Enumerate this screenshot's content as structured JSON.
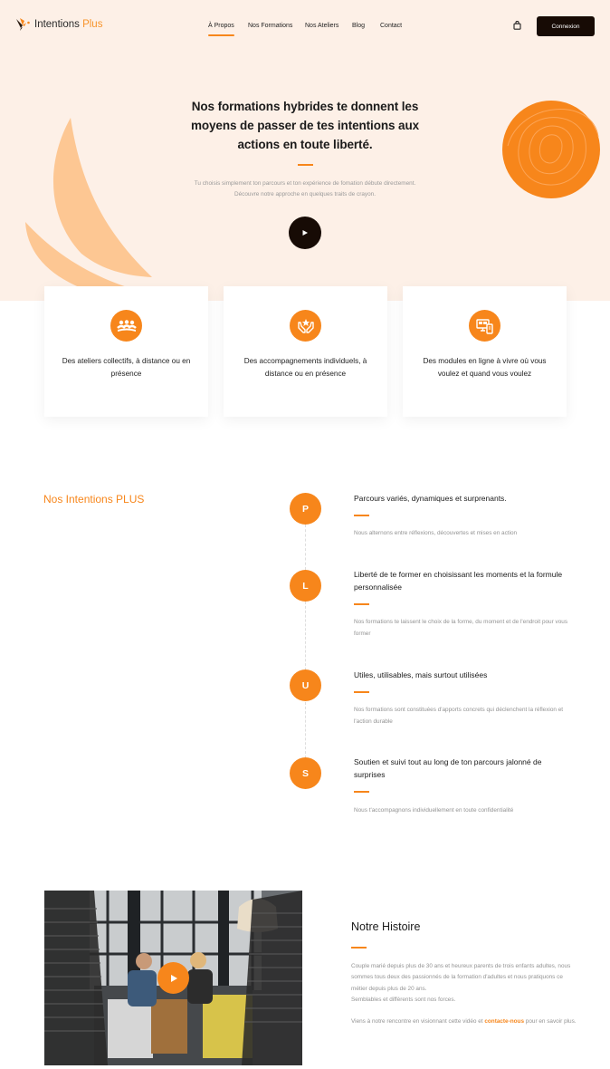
{
  "header": {
    "logo": {
      "name": "Intentions",
      "accent": "Plus"
    },
    "nav": [
      {
        "label": "À Propos",
        "active": true
      },
      {
        "label": "Nos Formations",
        "active": false
      },
      {
        "label": "Nos Ateliers",
        "active": false
      },
      {
        "label": "Blog",
        "active": false
      },
      {
        "label": "Contact",
        "active": false
      }
    ],
    "cart_icon": "shopping-bag-icon",
    "login_label": "Connexion"
  },
  "hero": {
    "title": "Nos formations hybrides te donnent les moyens de passer de tes intentions aux actions en toute liberté.",
    "subtitle_line1": "Tu choisis simplement ton parcours et ton expérience de fomation débute directement.",
    "subtitle_line2": "Découvre notre approche en quelques traits de crayon.",
    "play_icon": "play-icon"
  },
  "features": [
    {
      "icon": "group-meeting-icon",
      "text": "Des ateliers collectifs, à distance ou en présence"
    },
    {
      "icon": "hands-star-icon",
      "text": "Des accompagnements individuels, à distance ou en présence"
    },
    {
      "icon": "devices-icon",
      "text": "Des modules en ligne à vivre où vous voulez et quand vous voulez"
    }
  ],
  "intentions": {
    "title": "Nos Intentions PLUS",
    "steps": [
      {
        "letter": "P",
        "title": "Parcours variés, dynamiques et surprenants.",
        "desc": "Nous alternons entre réflexions, découvertes et mises en action"
      },
      {
        "letter": "L",
        "title": "Liberté de te former en choisissant les moments et la formule personnalisée",
        "desc": "Nos formations te laissent le choix de la forme, du moment et de l'endroit pour vous former"
      },
      {
        "letter": "U",
        "title": "Utiles, utilisables, mais surtout utilisées",
        "desc": "Nos formations sont constituées d'apports concrets qui déclenchent la réflexion et l'action durable"
      },
      {
        "letter": "S",
        "title": "Soutien et suivi tout au long de ton parcours jalonné de surprises",
        "desc": "Nous t'accompagnons individuellement en toute confidentialité"
      }
    ]
  },
  "histoire": {
    "title": "Notre Histoire",
    "p1": "Couple marié depuis plus de 30 ans et heureux parents de trois enfants adultes, nous sommes tous deux des passionnés de la formation d'adultes et nous pratiquons ce métier depuis plus de 20 ans.",
    "p1b": "Semblables et différents sont nos forces.",
    "p2_before": "Viens à notre rencontre en visionnant cette vidéo et ",
    "p2_link": "contacte-nous",
    "p2_after": " pour en savoir plus.",
    "photo_alt": "Two people talking in a meeting booth"
  },
  "colors": {
    "accent": "#f7861b",
    "dark": "#170b05",
    "hero_bg": "#fdf0e7"
  }
}
